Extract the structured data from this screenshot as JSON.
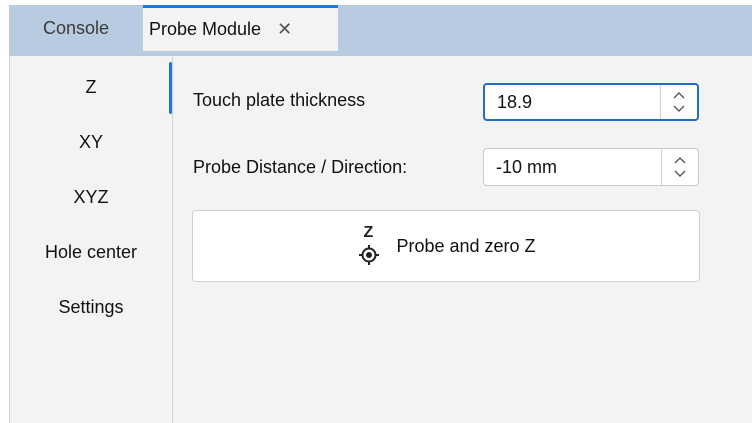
{
  "tabs": {
    "console": "Console",
    "probe_module": "Probe Module",
    "close_glyph": "✕"
  },
  "sidebar": {
    "items": [
      "Z",
      "XY",
      "XYZ",
      "Hole center",
      "Settings"
    ],
    "selected": "Z"
  },
  "probe_z": {
    "touch_plate_label": "Touch plate thickness",
    "touch_plate_value": "18.9",
    "distance_label": "Probe Distance / Direction:",
    "distance_value": "-10 mm",
    "action_button_label": "Probe and zero Z",
    "action_icon_letter": "Z",
    "action_icon_name": "probe-target-icon"
  },
  "colors": {
    "accent": "#1e7ad6",
    "tabbar": "#b8cbe0",
    "panel": "#f3f3f3"
  }
}
